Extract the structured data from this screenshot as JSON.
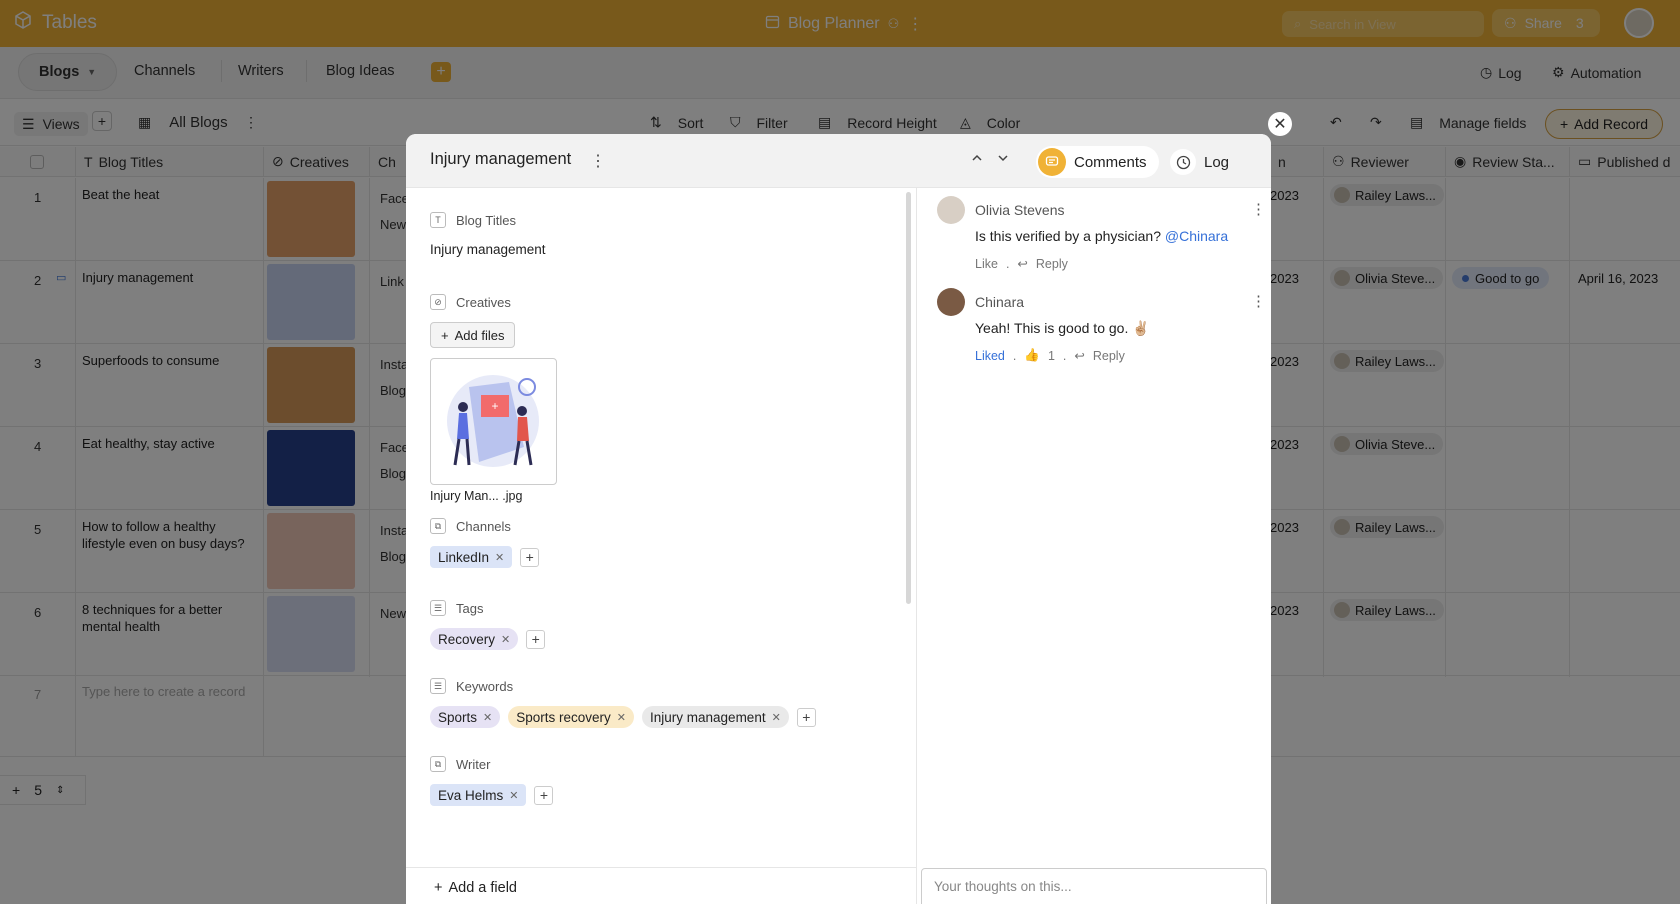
{
  "app": {
    "name": "Tables",
    "base_title": "Blog Planner",
    "search_placeholder": "Search in View",
    "share_label": "Share",
    "share_count": "3"
  },
  "tabs": {
    "active": "Blogs",
    "items": [
      "Channels",
      "Writers",
      "Blog Ideas"
    ],
    "log": "Log",
    "automation": "Automation"
  },
  "toolbar": {
    "views": "Views",
    "view_name": "All Blogs",
    "sort": "Sort",
    "filter": "Filter",
    "record_height": "Record Height",
    "color": "Color",
    "manage_fields": "Manage fields",
    "add_record": "Add Record"
  },
  "grid": {
    "headers": {
      "title": "Blog Titles",
      "creatives": "Creatives",
      "channels_partial": "Ch",
      "partial_n": "n",
      "reviewer": "Reviewer",
      "review_status": "Review Sta...",
      "published": "Published d"
    },
    "rows": [
      {
        "n": "1",
        "title": "Beat the heat",
        "ch": [
          "Face",
          "New"
        ],
        "yr": "2023",
        "reviewer": "Railey Laws...",
        "status": "",
        "pub": ""
      },
      {
        "n": "2",
        "title": "Injury management",
        "ch": [
          "Link"
        ],
        "yr": "2023",
        "reviewer": "Olivia Steve...",
        "status": "Good to go",
        "pub": "April 16, 2023"
      },
      {
        "n": "3",
        "title": "Superfoods to consume",
        "ch": [
          "Insta",
          "Blog"
        ],
        "yr": "2023",
        "reviewer": "Railey Laws...",
        "status": "",
        "pub": ""
      },
      {
        "n": "4",
        "title": "Eat healthy, stay active",
        "ch": [
          "Face",
          "Blog"
        ],
        "yr": "2023",
        "reviewer": "Olivia Steve...",
        "status": "",
        "pub": ""
      },
      {
        "n": "5",
        "title": "How to follow a healthy lifestyle even on busy days?",
        "ch": [
          "Insta",
          "Blog"
        ],
        "yr": "2023",
        "reviewer": "Railey Laws...",
        "status": "",
        "pub": ""
      },
      {
        "n": "6",
        "title": "8 techniques for a better mental health",
        "ch": [
          "New"
        ],
        "yr": "2023",
        "reviewer": "Railey Laws...",
        "status": "",
        "pub": ""
      }
    ],
    "new_row_n": "7",
    "new_row_placeholder": "Type here to create a record",
    "footer_count": "5"
  },
  "record": {
    "title": "Injury management",
    "comments_label": "Comments",
    "log_label": "Log",
    "fields": {
      "blog_titles": {
        "label": "Blog Titles",
        "value": "Injury management"
      },
      "creatives": {
        "label": "Creatives",
        "add_files": "Add files",
        "file_name": "Injury Man... .jpg"
      },
      "channels": {
        "label": "Channels",
        "chips": [
          "LinkedIn"
        ]
      },
      "tags": {
        "label": "Tags",
        "chips": [
          "Recovery"
        ]
      },
      "keywords": {
        "label": "Keywords",
        "chips": [
          "Sports",
          "Sports recovery",
          "Injury management"
        ]
      },
      "writer": {
        "label": "Writer",
        "chips": [
          "Eva Helms"
        ]
      }
    },
    "add_field": "Add a field"
  },
  "comments": [
    {
      "author": "Olivia Stevens",
      "text": "Is this verified by a physician?",
      "mention": "@Chinara",
      "like": "Like",
      "reply": "Reply"
    },
    {
      "author": "Chinara",
      "text": "Yeah! This is good to go. ✌🏼",
      "like": "Liked",
      "likes": "1",
      "reply": "Reply"
    }
  ],
  "comment_input_placeholder": "Your thoughts on this...",
  "colors": {
    "brand": "#f0b236",
    "link": "#3570d8"
  }
}
